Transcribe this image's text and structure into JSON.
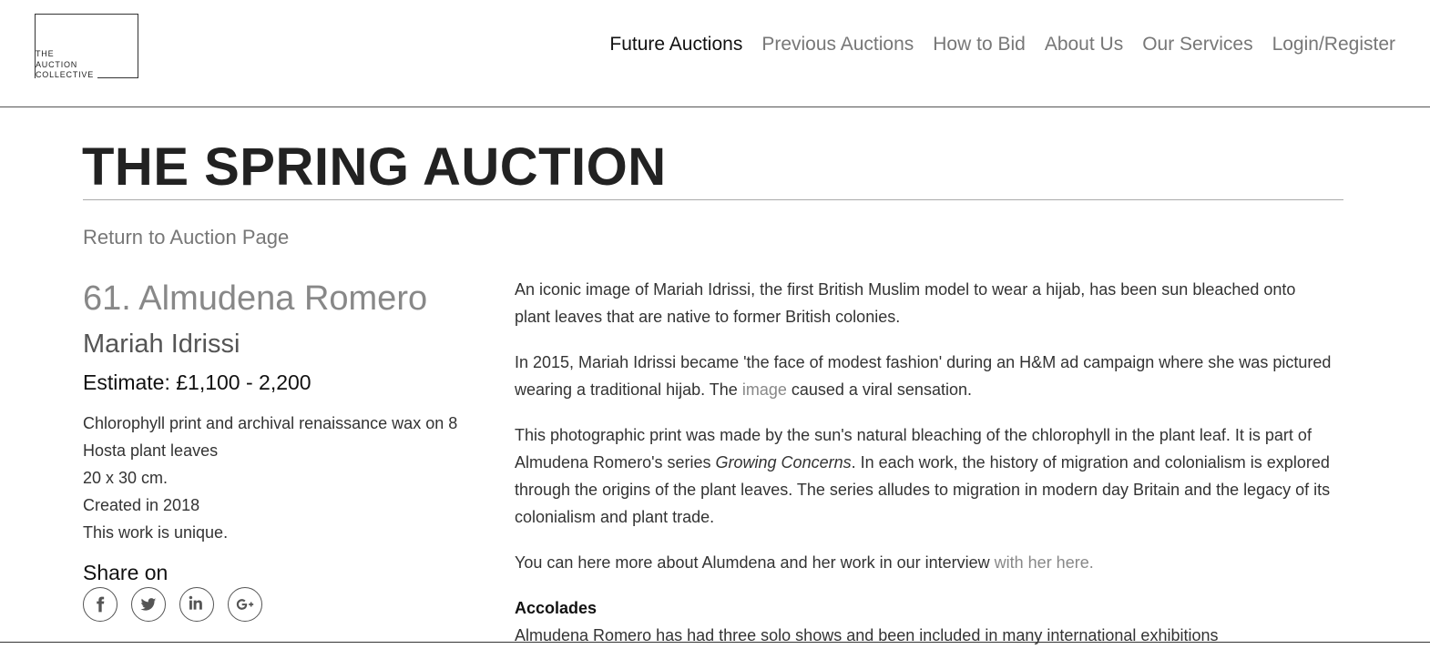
{
  "logo": {
    "lines": [
      "The",
      "Auction",
      "Collective"
    ]
  },
  "nav": {
    "items": [
      {
        "label": "Future Auctions",
        "active": true
      },
      {
        "label": "Previous Auctions"
      },
      {
        "label": "How to Bid"
      },
      {
        "label": "About Us"
      },
      {
        "label": "Our Services"
      },
      {
        "label": "Login/Register"
      }
    ]
  },
  "page": {
    "title": "THE SPRING AUCTION",
    "return_link": "Return to Auction Page"
  },
  "lot": {
    "title": "61. Almudena Romero",
    "work_title": "Mariah Idrissi",
    "estimate": "Estimate: £1,100 - 2,200",
    "details": [
      "Chlorophyll print and archival renaissance wax on 8 Hosta plant leaves",
      "20 x 30 cm.",
      "Created in 2018",
      "This work is unique."
    ],
    "share_label": "Share on",
    "share_icons": [
      "facebook-icon",
      "twitter-icon",
      "linkedin-icon",
      "google-plus-icon"
    ]
  },
  "description": {
    "p1": "An iconic image of Mariah Idrissi, the first British Muslim model to wear a hijab, has been sun bleached onto plant leaves that are native to former British colonies.",
    "p2_before": "In 2015, Mariah Idrissi became 'the face of modest fashion' during an H&M ad campaign where she was pictured wearing a traditional hijab. The ",
    "p2_link": "image",
    "p2_after": " caused a viral sensation.",
    "p3_before": "This photographic print was made by the sun's natural bleaching of the chlorophyll in the plant leaf. It is part of Almudena Romero's series ",
    "p3_italic": "Growing Concerns",
    "p3_after": ". In each work, the history of migration and colonialism is explored through the origins of the plant leaves. The series alludes to migration in modern day Britain and the legacy of its colonialism and plant trade.",
    "p4_before": "You can here more about Alumdena and her work in our interview ",
    "p4_link": "with her here.",
    "accolades_heading": "Accolades",
    "accolades_text": "Almudena Romero has had three solo shows and been included in many international exhibitions"
  }
}
